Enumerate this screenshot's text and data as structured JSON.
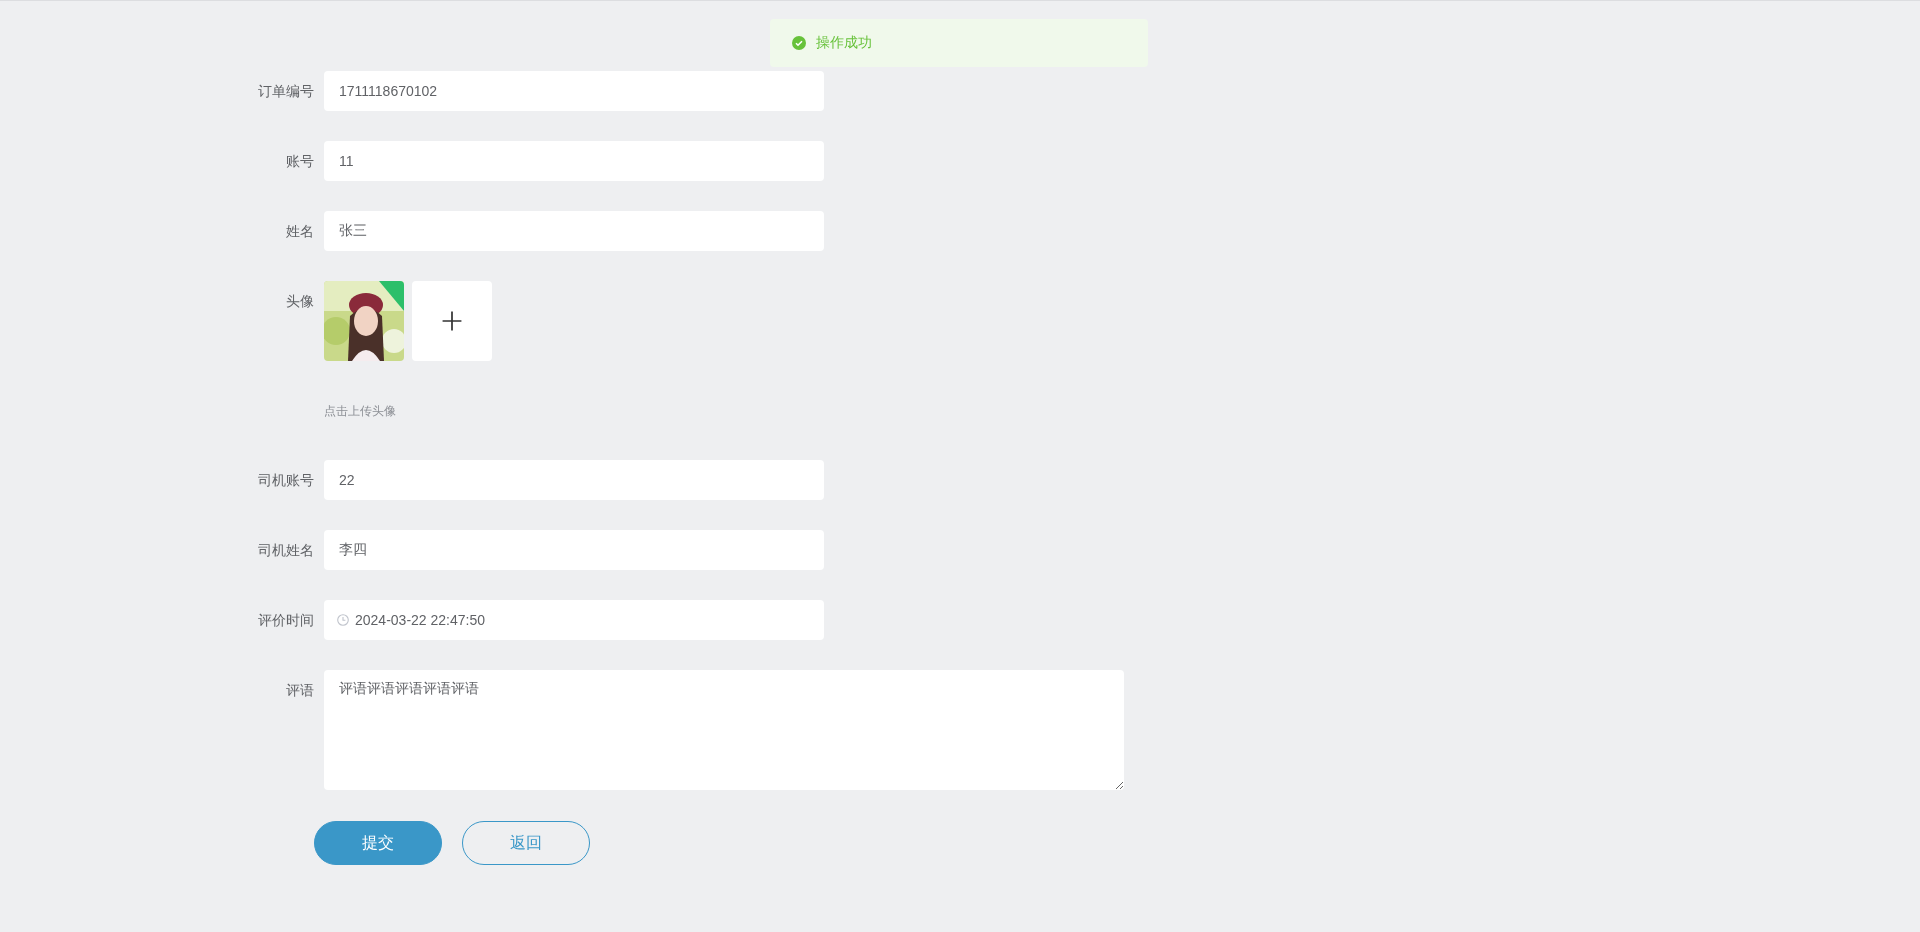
{
  "toast": {
    "kind": "success",
    "message": "操作成功"
  },
  "fields": [
    {
      "kind": "text",
      "label": "订单编号",
      "value": "1711118670102"
    },
    {
      "kind": "text",
      "label": "账号",
      "value": "11"
    },
    {
      "kind": "text",
      "label": "姓名",
      "value": "张三"
    },
    {
      "label": "头像",
      "hint": "点击上传头像"
    },
    {
      "kind": "text",
      "label": "司机账号",
      "value": "22"
    },
    {
      "kind": "text",
      "label": "司机姓名",
      "value": "李四"
    },
    {
      "kind": "datetime",
      "label": "评价时间",
      "value": "2024-03-22 22:47:50"
    },
    {
      "kind": "textarea",
      "label": "评语",
      "value": "评语评语评语评语评语"
    }
  ],
  "buttons": [
    {
      "kind": "primary",
      "label": "提交"
    },
    {
      "kind": "secondary",
      "label": "返回"
    }
  ]
}
